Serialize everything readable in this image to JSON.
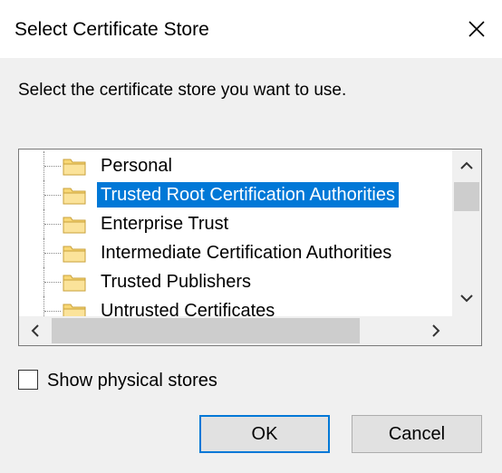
{
  "dialog": {
    "title": "Select Certificate Store",
    "prompt": "Select the certificate store you want to use."
  },
  "tree": {
    "items": [
      {
        "label": "Personal",
        "selected": false
      },
      {
        "label": "Trusted Root Certification Authorities",
        "selected": true
      },
      {
        "label": "Enterprise Trust",
        "selected": false
      },
      {
        "label": "Intermediate Certification Authorities",
        "selected": false
      },
      {
        "label": "Trusted Publishers",
        "selected": false
      },
      {
        "label": "Untrusted Certificates",
        "selected": false
      }
    ],
    "icon": "folder-icon"
  },
  "options": {
    "show_physical_label": "Show physical stores",
    "show_physical_checked": false
  },
  "buttons": {
    "ok_label": "OK",
    "cancel_label": "Cancel"
  },
  "colors": {
    "selection": "#0078d7",
    "folder": "#f8d775"
  }
}
